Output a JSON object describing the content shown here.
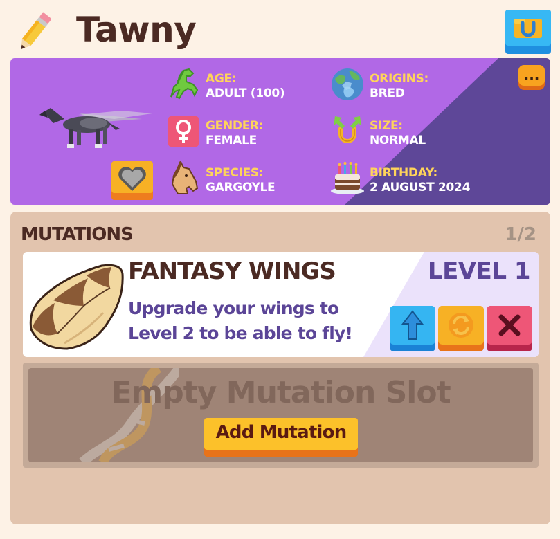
{
  "header": {
    "title": "Tawny",
    "edit_icon": "pencil-icon",
    "tack_icon": "horseshoe-icon"
  },
  "info": {
    "more_label": "...",
    "stats": {
      "age": {
        "label": "AGE:",
        "value": "ADULT (100)",
        "icon": "green-horse-icon"
      },
      "gender": {
        "label": "GENDER:",
        "value": "FEMALE",
        "icon": "female-symbol-icon"
      },
      "species": {
        "label": "SPECIES:",
        "value": "GARGOYLE",
        "icon": "horse-head-icon"
      },
      "origins": {
        "label": "ORIGINS:",
        "value": "BRED",
        "icon": "globe-icon"
      },
      "size": {
        "label": "SIZE:",
        "value": "NORMAL",
        "icon": "horseshoe-arrows-icon"
      },
      "birthday": {
        "label": "BIRTHDAY:",
        "value": "2 AUGUST 2024",
        "icon": "cake-icon"
      }
    }
  },
  "mutations": {
    "title": "MUTATIONS",
    "count": "1/2",
    "items": [
      {
        "name": "FANTASY WINGS",
        "level": "LEVEL 1",
        "description": "Upgrade your wings to Level 2 to be able to fly!",
        "icon": "fantasy-wing-icon",
        "actions": [
          "up-arrow-icon",
          "reroll-icon",
          "close-x-icon"
        ]
      }
    ],
    "empty_slot": {
      "label": "Empty Mutation Slot",
      "button_label": "Add Mutation",
      "icon": "dna-icon"
    }
  },
  "colors": {
    "background": "#fdf2e6",
    "info_panel": "#b168e6",
    "info_panel_dark": "#5e4798",
    "label_yellow": "#ffd45a",
    "title_brown": "#4b2a23",
    "level_purple": "#5b4597",
    "mutations_panel": "#e2c4ae"
  }
}
